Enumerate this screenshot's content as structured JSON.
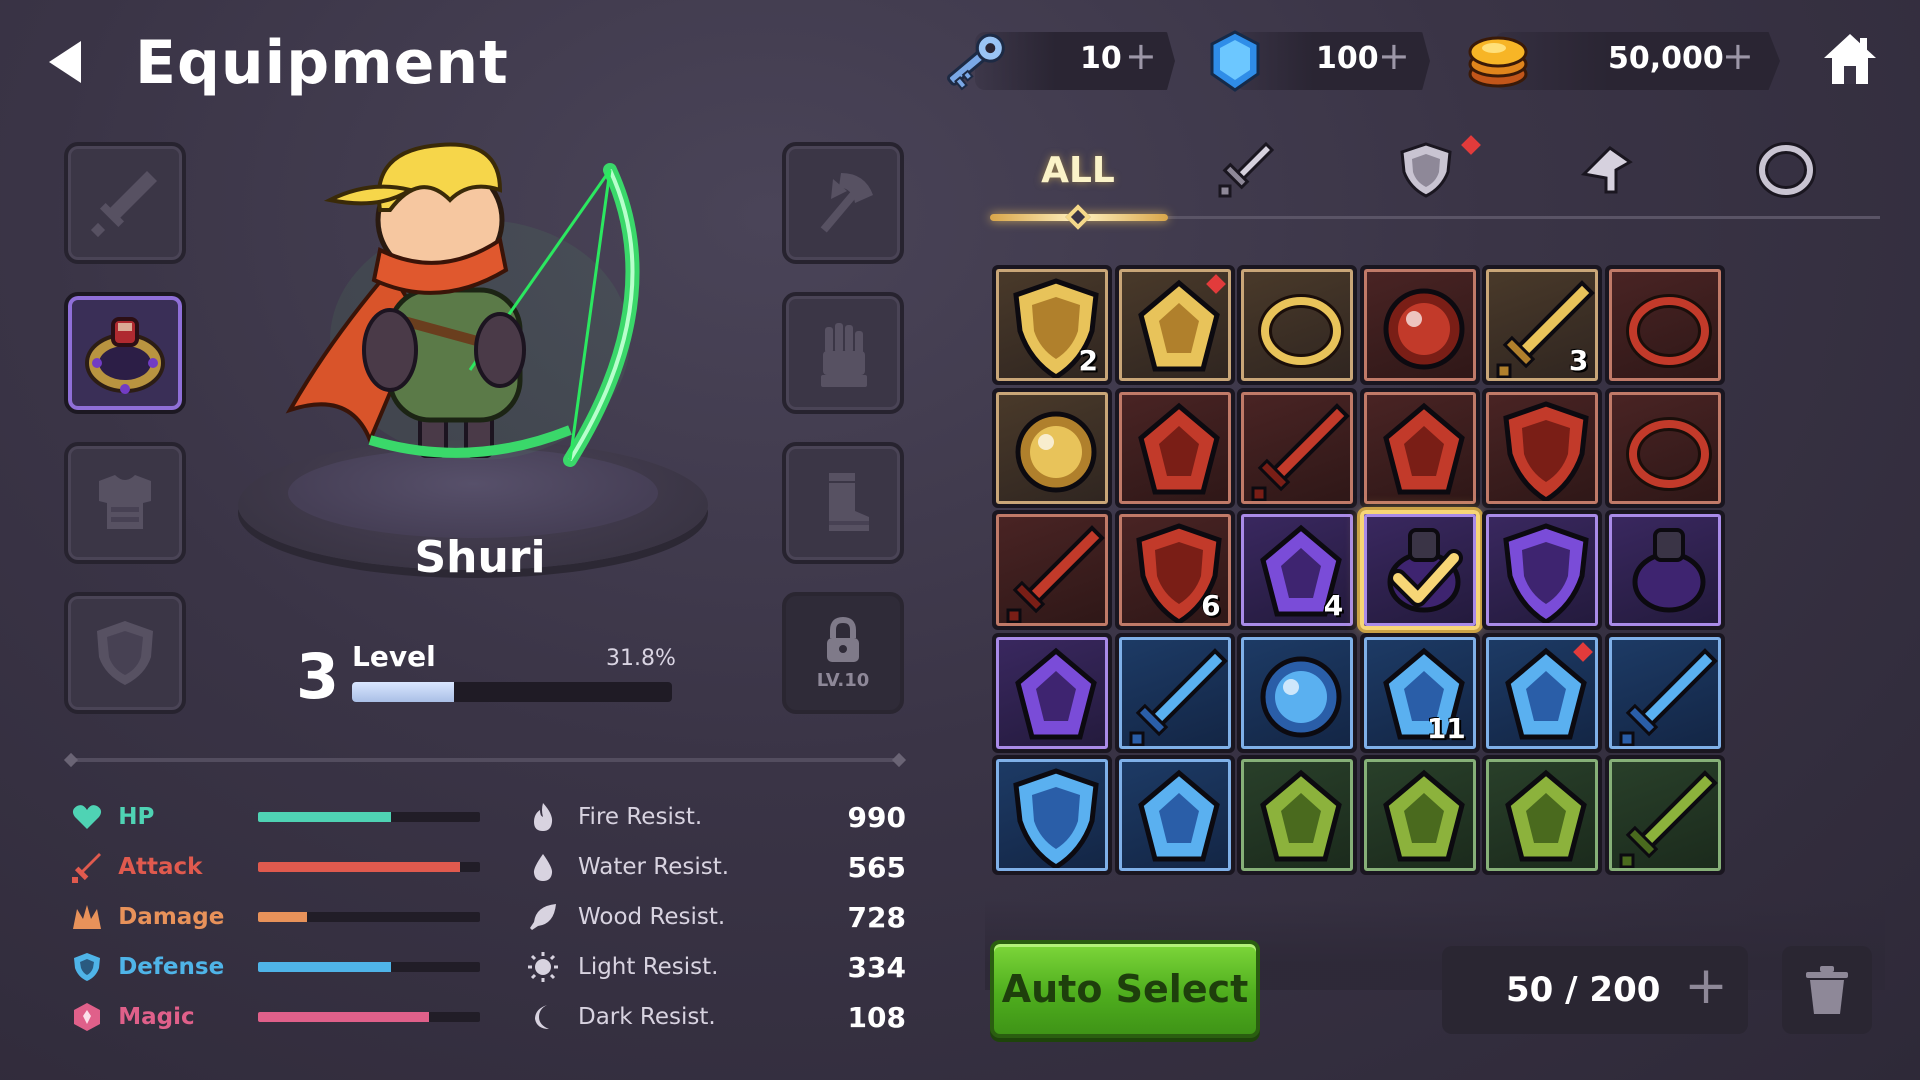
{
  "header": {
    "title": "Equipment",
    "currencies": [
      {
        "name": "key-icon",
        "value": "10"
      },
      {
        "name": "gem-icon",
        "value": "100"
      },
      {
        "name": "coin-icon",
        "value": "50,000"
      }
    ]
  },
  "character": {
    "name": "Shuri",
    "level": "3",
    "level_label": "Level",
    "level_progress_text": "31.8%",
    "level_progress": 0.318
  },
  "locked_slot": {
    "label": "LV.10"
  },
  "stats": [
    {
      "label": "HP",
      "color": "#4fd3b4",
      "fill": 0.6,
      "icon": "heart-icon"
    },
    {
      "label": "Attack",
      "color": "#e05a4e",
      "fill": 0.91,
      "icon": "sword-icon"
    },
    {
      "label": "Damage",
      "color": "#e8925a",
      "fill": 0.22,
      "icon": "burst-icon"
    },
    {
      "label": "Defense",
      "color": "#4fb4e8",
      "fill": 0.6,
      "icon": "shield-icon"
    },
    {
      "label": "Magic",
      "color": "#e0608a",
      "fill": 0.77,
      "icon": "magic-icon"
    }
  ],
  "resists": [
    {
      "label": "Fire Resist.",
      "value": "990",
      "icon": "fire-icon"
    },
    {
      "label": "Water Resist.",
      "value": "565",
      "icon": "water-icon"
    },
    {
      "label": "Wood Resist.",
      "value": "728",
      "icon": "leaf-icon"
    },
    {
      "label": "Light Resist.",
      "value": "334",
      "icon": "sun-icon"
    },
    {
      "label": "Dark Resist.",
      "value": "108",
      "icon": "moon-icon"
    }
  ],
  "tabs": {
    "all_label": "ALL"
  },
  "inventory": {
    "items": [
      {
        "tier": "gold",
        "icon": "gold-chestplate-icon",
        "count": "2"
      },
      {
        "tier": "gold",
        "icon": "thorn-crown-icon",
        "count": ""
      },
      {
        "tier": "gold",
        "icon": "gold-ring-icon",
        "count": ""
      },
      {
        "tier": "red",
        "icon": "flame-orb-icon",
        "count": ""
      },
      {
        "tier": "gold",
        "icon": "gold-axe-icon",
        "count": "3"
      },
      {
        "tier": "red",
        "icon": "red-seal-icon",
        "count": ""
      },
      {
        "tier": "gold",
        "icon": "cyan-orb-icon",
        "count": ""
      },
      {
        "tier": "red",
        "icon": "red-gem-icon",
        "count": ""
      },
      {
        "tier": "red",
        "icon": "red-sword-icon",
        "count": ""
      },
      {
        "tier": "red",
        "icon": "red-helmet-icon",
        "count": ""
      },
      {
        "tier": "red",
        "icon": "red-crest-icon",
        "count": ""
      },
      {
        "tier": "red",
        "icon": "red-ring-icon",
        "count": ""
      },
      {
        "tier": "red",
        "icon": "red-axe-icon",
        "count": ""
      },
      {
        "tier": "red",
        "icon": "red-shield-icon",
        "count": "6"
      },
      {
        "tier": "purple",
        "icon": "purple-herb-icon",
        "count": "4"
      },
      {
        "tier": "purple",
        "icon": "amulet-selected-icon",
        "count": ""
      },
      {
        "tier": "purple",
        "icon": "purple-demon-icon",
        "count": ""
      },
      {
        "tier": "purple",
        "icon": "pendant-icon",
        "count": ""
      },
      {
        "tier": "purple",
        "icon": "shadow-claw-icon",
        "count": ""
      },
      {
        "tier": "blue",
        "icon": "ice-sword-icon",
        "count": ""
      },
      {
        "tier": "blue",
        "icon": "blue-potion-icon",
        "count": ""
      },
      {
        "tier": "blue",
        "icon": "blue-dust-icon",
        "count": "11"
      },
      {
        "tier": "blue",
        "icon": "blue-crystal-icon",
        "count": ""
      },
      {
        "tier": "blue",
        "icon": "blue-hammer-icon",
        "count": ""
      },
      {
        "tier": "blue",
        "icon": "blue-shield-icon",
        "count": ""
      },
      {
        "tier": "blue",
        "icon": "blue-chest-icon",
        "count": ""
      },
      {
        "tier": "green",
        "icon": "green-leaf-icon",
        "count": ""
      },
      {
        "tier": "green",
        "icon": "green-wreath-icon",
        "count": ""
      },
      {
        "tier": "green",
        "icon": "green-moss-icon",
        "count": ""
      },
      {
        "tier": "green",
        "icon": "green-staff-icon",
        "count": ""
      }
    ],
    "capacity_text": "50 / 200"
  },
  "buttons": {
    "auto_select": "Auto Select"
  }
}
